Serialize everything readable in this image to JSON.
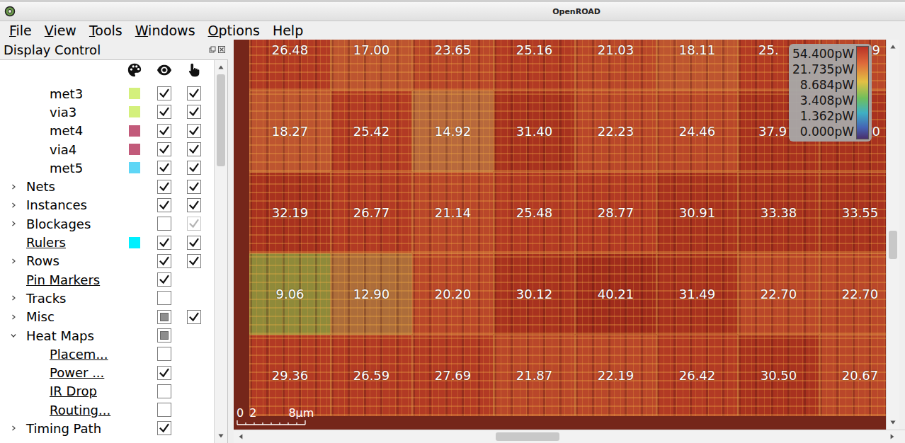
{
  "window": {
    "title": "OpenROAD"
  },
  "menu": [
    {
      "label": "File",
      "mnemonic": true
    },
    {
      "label": "View",
      "mnemonic": true
    },
    {
      "label": "Tools",
      "mnemonic": true
    },
    {
      "label": "Windows",
      "mnemonic": true
    },
    {
      "label": "Options",
      "mnemonic": true
    },
    {
      "label": "Help",
      "mnemonic": false
    }
  ],
  "display_control": {
    "title": "Display Control",
    "items": [
      {
        "label": "met3",
        "level": 1,
        "expandable": false,
        "expanded": false,
        "color": "#d4f07c",
        "underlined": false,
        "visible": true,
        "visible_partial": false,
        "has_selectable_box": true,
        "selectable": true,
        "selectable_disabled": false
      },
      {
        "label": "via3",
        "level": 1,
        "expandable": false,
        "expanded": false,
        "color": "#d4f07c",
        "underlined": false,
        "visible": true,
        "visible_partial": false,
        "has_selectable_box": true,
        "selectable": true,
        "selectable_disabled": false
      },
      {
        "label": "met4",
        "level": 1,
        "expandable": false,
        "expanded": false,
        "color": "#c25a7a",
        "underlined": false,
        "visible": true,
        "visible_partial": false,
        "has_selectable_box": true,
        "selectable": true,
        "selectable_disabled": false
      },
      {
        "label": "via4",
        "level": 1,
        "expandable": false,
        "expanded": false,
        "color": "#c25a7a",
        "underlined": false,
        "visible": true,
        "visible_partial": false,
        "has_selectable_box": true,
        "selectable": true,
        "selectable_disabled": false
      },
      {
        "label": "met5",
        "level": 1,
        "expandable": false,
        "expanded": false,
        "color": "#5fd6f6",
        "underlined": false,
        "visible": true,
        "visible_partial": false,
        "has_selectable_box": true,
        "selectable": true,
        "selectable_disabled": false
      },
      {
        "label": "Nets",
        "level": 0,
        "expandable": true,
        "expanded": false,
        "color": "",
        "underlined": false,
        "visible": true,
        "visible_partial": false,
        "has_selectable_box": true,
        "selectable": true,
        "selectable_disabled": false
      },
      {
        "label": "Instances",
        "level": 0,
        "expandable": true,
        "expanded": false,
        "color": "",
        "underlined": false,
        "visible": true,
        "visible_partial": false,
        "has_selectable_box": true,
        "selectable": true,
        "selectable_disabled": false
      },
      {
        "label": "Blockages",
        "level": 0,
        "expandable": true,
        "expanded": false,
        "color": "",
        "underlined": false,
        "visible": false,
        "visible_partial": false,
        "has_selectable_box": true,
        "selectable": true,
        "selectable_disabled": true
      },
      {
        "label": "Rulers",
        "level": 0,
        "expandable": false,
        "expanded": false,
        "color": "#00f0ff",
        "underlined": true,
        "visible": true,
        "visible_partial": false,
        "has_selectable_box": true,
        "selectable": true,
        "selectable_disabled": false
      },
      {
        "label": "Rows",
        "level": 0,
        "expandable": true,
        "expanded": false,
        "color": "",
        "underlined": false,
        "visible": true,
        "visible_partial": false,
        "has_selectable_box": true,
        "selectable": true,
        "selectable_disabled": false
      },
      {
        "label": "Pin Markers",
        "level": 0,
        "expandable": false,
        "expanded": false,
        "color": "",
        "underlined": true,
        "visible": true,
        "visible_partial": false,
        "has_selectable_box": false,
        "selectable": false,
        "selectable_disabled": false
      },
      {
        "label": "Tracks",
        "level": 0,
        "expandable": true,
        "expanded": false,
        "color": "",
        "underlined": false,
        "visible": false,
        "visible_partial": false,
        "has_selectable_box": false,
        "selectable": false,
        "selectable_disabled": false
      },
      {
        "label": "Misc",
        "level": 0,
        "expandable": true,
        "expanded": false,
        "color": "",
        "underlined": false,
        "visible": false,
        "visible_partial": true,
        "has_selectable_box": true,
        "selectable": true,
        "selectable_disabled": false
      },
      {
        "label": "Heat Maps",
        "level": 0,
        "expandable": true,
        "expanded": true,
        "color": "",
        "underlined": false,
        "visible": false,
        "visible_partial": true,
        "has_selectable_box": false,
        "selectable": false,
        "selectable_disabled": false
      },
      {
        "label": "Placem...",
        "level": 1,
        "expandable": false,
        "expanded": false,
        "color": "",
        "underlined": true,
        "visible": false,
        "visible_partial": false,
        "has_selectable_box": false,
        "selectable": false,
        "selectable_disabled": false
      },
      {
        "label": "Power ...",
        "level": 1,
        "expandable": false,
        "expanded": false,
        "color": "",
        "underlined": true,
        "visible": true,
        "visible_partial": false,
        "has_selectable_box": false,
        "selectable": false,
        "selectable_disabled": false
      },
      {
        "label": "IR Drop",
        "level": 1,
        "expandable": false,
        "expanded": false,
        "color": "",
        "underlined": true,
        "visible": false,
        "visible_partial": false,
        "has_selectable_box": false,
        "selectable": false,
        "selectable_disabled": false
      },
      {
        "label": "Routing...",
        "level": 1,
        "expandable": false,
        "expanded": false,
        "color": "",
        "underlined": true,
        "visible": false,
        "visible_partial": false,
        "has_selectable_box": false,
        "selectable": false,
        "selectable_disabled": false
      },
      {
        "label": "Timing Path",
        "level": 0,
        "expandable": true,
        "expanded": false,
        "color": "",
        "underlined": false,
        "visible": true,
        "visible_partial": false,
        "has_selectable_box": false,
        "selectable": false,
        "selectable_disabled": false
      }
    ]
  },
  "heat_map": {
    "rows": [
      [
        {
          "text": "26.48",
          "color": "#b23a24",
          "clipped": "none"
        },
        {
          "text": "17.00",
          "color": "#bd5530",
          "clipped": "none"
        },
        {
          "text": "23.65",
          "color": "#b9472a",
          "clipped": "none"
        },
        {
          "text": "25.16",
          "color": "#b23a24",
          "clipped": "none"
        },
        {
          "text": "21.03",
          "color": "#b9472a",
          "clipped": "none"
        },
        {
          "text": "18.11",
          "color": "#bd5530",
          "clipped": "none"
        },
        {
          "text": "25.",
          "color": "#b23a24",
          "clipped": "end"
        },
        {
          "text": "9",
          "color": "#b9472a",
          "clipped": "start"
        }
      ],
      [
        {
          "text": "18.27",
          "color": "#bd5530",
          "clipped": "none"
        },
        {
          "text": "25.42",
          "color": "#b23a24",
          "clipped": "none"
        },
        {
          "text": "14.92",
          "color": "#b8693c",
          "clipped": "none"
        },
        {
          "text": "31.40",
          "color": "#a8321f",
          "clipped": "none"
        },
        {
          "text": "22.23",
          "color": "#b9472a",
          "clipped": "none"
        },
        {
          "text": "24.46",
          "color": "#b9472a",
          "clipped": "none"
        },
        {
          "text": "37.9",
          "color": "#a8321f",
          "clipped": "end"
        },
        {
          "text": "0",
          "color": "#a8321f",
          "clipped": "start"
        }
      ],
      [
        {
          "text": "32.19",
          "color": "#a8321f",
          "clipped": "none"
        },
        {
          "text": "26.77",
          "color": "#b23a24",
          "clipped": "none"
        },
        {
          "text": "21.14",
          "color": "#b9472a",
          "clipped": "none"
        },
        {
          "text": "25.48",
          "color": "#b23a24",
          "clipped": "none"
        },
        {
          "text": "28.77",
          "color": "#b23a24",
          "clipped": "none"
        },
        {
          "text": "30.91",
          "color": "#a8321f",
          "clipped": "none"
        },
        {
          "text": "33.38",
          "color": "#a8321f",
          "clipped": "none"
        },
        {
          "text": "33.55",
          "color": "#a8321f",
          "clipped": "none"
        }
      ],
      [
        {
          "text": "9.06",
          "color": "#8f8a3a",
          "clipped": "none"
        },
        {
          "text": "12.90",
          "color": "#ad6d3a",
          "clipped": "none"
        },
        {
          "text": "20.20",
          "color": "#b9472a",
          "clipped": "none"
        },
        {
          "text": "30.12",
          "color": "#a8321f",
          "clipped": "none"
        },
        {
          "text": "40.21",
          "color": "#a02c1c",
          "clipped": "none"
        },
        {
          "text": "31.49",
          "color": "#a8321f",
          "clipped": "none"
        },
        {
          "text": "22.70",
          "color": "#b9472a",
          "clipped": "none"
        },
        {
          "text": "22.70",
          "color": "#b9472a",
          "clipped": "none"
        }
      ],
      [
        {
          "text": "29.36",
          "color": "#b23a24",
          "clipped": "none"
        },
        {
          "text": "26.59",
          "color": "#b23a24",
          "clipped": "none"
        },
        {
          "text": "27.69",
          "color": "#b23a24",
          "clipped": "none"
        },
        {
          "text": "21.87",
          "color": "#b9472a",
          "clipped": "none"
        },
        {
          "text": "22.19",
          "color": "#b9472a",
          "clipped": "none"
        },
        {
          "text": "26.42",
          "color": "#b23a24",
          "clipped": "none"
        },
        {
          "text": "30.50",
          "color": "#a8321f",
          "clipped": "none"
        },
        {
          "text": "20.67",
          "color": "#b9472a",
          "clipped": "none"
        }
      ]
    ]
  },
  "legend": {
    "labels": [
      "54.400pW",
      "21.735pW",
      "8.684pW",
      "3.408pW",
      "1.362pW",
      "0.000pW"
    ]
  },
  "scale_bar": {
    "labels": [
      "0",
      "2",
      "8µm"
    ]
  }
}
